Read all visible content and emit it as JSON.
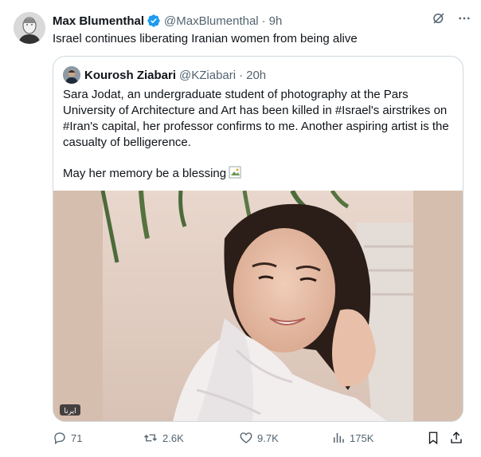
{
  "tweet": {
    "author_name": "Max Blumenthal",
    "handle": "@MaxBlumenthal",
    "separator": "·",
    "time": "9h",
    "text": "Israel continues liberating Iranian women from being alive"
  },
  "quote": {
    "author_name": "Kourosh Ziabari",
    "handle": "@KZiabari",
    "separator": "·",
    "time": "20h",
    "paragraph1": "Sara Jodat, an undergraduate student of photography at the Pars University of Architecture and Art has been killed in #Israel's airstrikes on #Iran's capital, her professor confirms to me. Another aspiring artist is the casualty of belligerence.",
    "paragraph2": "May her memory be a blessing",
    "media_watermark": "ایرنا"
  },
  "actions": {
    "replies": "71",
    "reposts": "2.6K",
    "likes": "9.7K",
    "views": "175K"
  },
  "colors": {
    "verified_blue": "#1d9bf0",
    "muted_text": "#536471",
    "border": "#cfd9de",
    "media_background": "#d6beaf"
  },
  "icons": [
    "verified-badge-icon",
    "grok-icon",
    "more-icon",
    "reply-icon",
    "repost-icon",
    "like-icon",
    "views-icon",
    "bookmark-icon",
    "share-icon"
  ]
}
